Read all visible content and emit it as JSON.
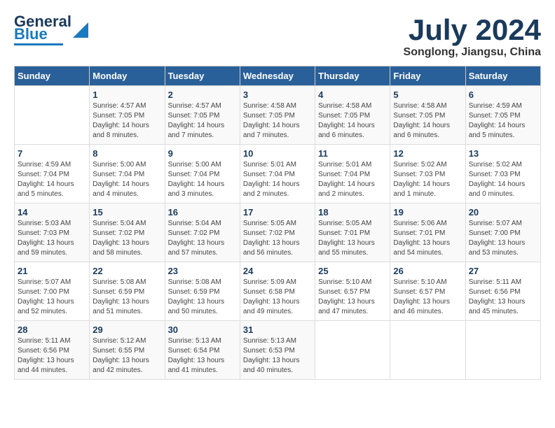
{
  "logo": {
    "line1": "General",
    "line2": "Blue"
  },
  "header": {
    "month_year": "July 2024",
    "location": "Songlong, Jiangsu, China"
  },
  "days_of_week": [
    "Sunday",
    "Monday",
    "Tuesday",
    "Wednesday",
    "Thursday",
    "Friday",
    "Saturday"
  ],
  "weeks": [
    [
      {
        "day": "",
        "info": ""
      },
      {
        "day": "1",
        "info": "Sunrise: 4:57 AM\nSunset: 7:05 PM\nDaylight: 14 hours\nand 8 minutes."
      },
      {
        "day": "2",
        "info": "Sunrise: 4:57 AM\nSunset: 7:05 PM\nDaylight: 14 hours\nand 7 minutes."
      },
      {
        "day": "3",
        "info": "Sunrise: 4:58 AM\nSunset: 7:05 PM\nDaylight: 14 hours\nand 7 minutes."
      },
      {
        "day": "4",
        "info": "Sunrise: 4:58 AM\nSunset: 7:05 PM\nDaylight: 14 hours\nand 6 minutes."
      },
      {
        "day": "5",
        "info": "Sunrise: 4:58 AM\nSunset: 7:05 PM\nDaylight: 14 hours\nand 6 minutes."
      },
      {
        "day": "6",
        "info": "Sunrise: 4:59 AM\nSunset: 7:05 PM\nDaylight: 14 hours\nand 5 minutes."
      }
    ],
    [
      {
        "day": "7",
        "info": "Sunrise: 4:59 AM\nSunset: 7:04 PM\nDaylight: 14 hours\nand 5 minutes."
      },
      {
        "day": "8",
        "info": "Sunrise: 5:00 AM\nSunset: 7:04 PM\nDaylight: 14 hours\nand 4 minutes."
      },
      {
        "day": "9",
        "info": "Sunrise: 5:00 AM\nSunset: 7:04 PM\nDaylight: 14 hours\nand 3 minutes."
      },
      {
        "day": "10",
        "info": "Sunrise: 5:01 AM\nSunset: 7:04 PM\nDaylight: 14 hours\nand 2 minutes."
      },
      {
        "day": "11",
        "info": "Sunrise: 5:01 AM\nSunset: 7:04 PM\nDaylight: 14 hours\nand 2 minutes."
      },
      {
        "day": "12",
        "info": "Sunrise: 5:02 AM\nSunset: 7:03 PM\nDaylight: 14 hours\nand 1 minute."
      },
      {
        "day": "13",
        "info": "Sunrise: 5:02 AM\nSunset: 7:03 PM\nDaylight: 14 hours\nand 0 minutes."
      }
    ],
    [
      {
        "day": "14",
        "info": "Sunrise: 5:03 AM\nSunset: 7:03 PM\nDaylight: 13 hours\nand 59 minutes."
      },
      {
        "day": "15",
        "info": "Sunrise: 5:04 AM\nSunset: 7:02 PM\nDaylight: 13 hours\nand 58 minutes."
      },
      {
        "day": "16",
        "info": "Sunrise: 5:04 AM\nSunset: 7:02 PM\nDaylight: 13 hours\nand 57 minutes."
      },
      {
        "day": "17",
        "info": "Sunrise: 5:05 AM\nSunset: 7:02 PM\nDaylight: 13 hours\nand 56 minutes."
      },
      {
        "day": "18",
        "info": "Sunrise: 5:05 AM\nSunset: 7:01 PM\nDaylight: 13 hours\nand 55 minutes."
      },
      {
        "day": "19",
        "info": "Sunrise: 5:06 AM\nSunset: 7:01 PM\nDaylight: 13 hours\nand 54 minutes."
      },
      {
        "day": "20",
        "info": "Sunrise: 5:07 AM\nSunset: 7:00 PM\nDaylight: 13 hours\nand 53 minutes."
      }
    ],
    [
      {
        "day": "21",
        "info": "Sunrise: 5:07 AM\nSunset: 7:00 PM\nDaylight: 13 hours\nand 52 minutes."
      },
      {
        "day": "22",
        "info": "Sunrise: 5:08 AM\nSunset: 6:59 PM\nDaylight: 13 hours\nand 51 minutes."
      },
      {
        "day": "23",
        "info": "Sunrise: 5:08 AM\nSunset: 6:59 PM\nDaylight: 13 hours\nand 50 minutes."
      },
      {
        "day": "24",
        "info": "Sunrise: 5:09 AM\nSunset: 6:58 PM\nDaylight: 13 hours\nand 49 minutes."
      },
      {
        "day": "25",
        "info": "Sunrise: 5:10 AM\nSunset: 6:57 PM\nDaylight: 13 hours\nand 47 minutes."
      },
      {
        "day": "26",
        "info": "Sunrise: 5:10 AM\nSunset: 6:57 PM\nDaylight: 13 hours\nand 46 minutes."
      },
      {
        "day": "27",
        "info": "Sunrise: 5:11 AM\nSunset: 6:56 PM\nDaylight: 13 hours\nand 45 minutes."
      }
    ],
    [
      {
        "day": "28",
        "info": "Sunrise: 5:11 AM\nSunset: 6:56 PM\nDaylight: 13 hours\nand 44 minutes."
      },
      {
        "day": "29",
        "info": "Sunrise: 5:12 AM\nSunset: 6:55 PM\nDaylight: 13 hours\nand 42 minutes."
      },
      {
        "day": "30",
        "info": "Sunrise: 5:13 AM\nSunset: 6:54 PM\nDaylight: 13 hours\nand 41 minutes."
      },
      {
        "day": "31",
        "info": "Sunrise: 5:13 AM\nSunset: 6:53 PM\nDaylight: 13 hours\nand 40 minutes."
      },
      {
        "day": "",
        "info": ""
      },
      {
        "day": "",
        "info": ""
      },
      {
        "day": "",
        "info": ""
      }
    ]
  ]
}
